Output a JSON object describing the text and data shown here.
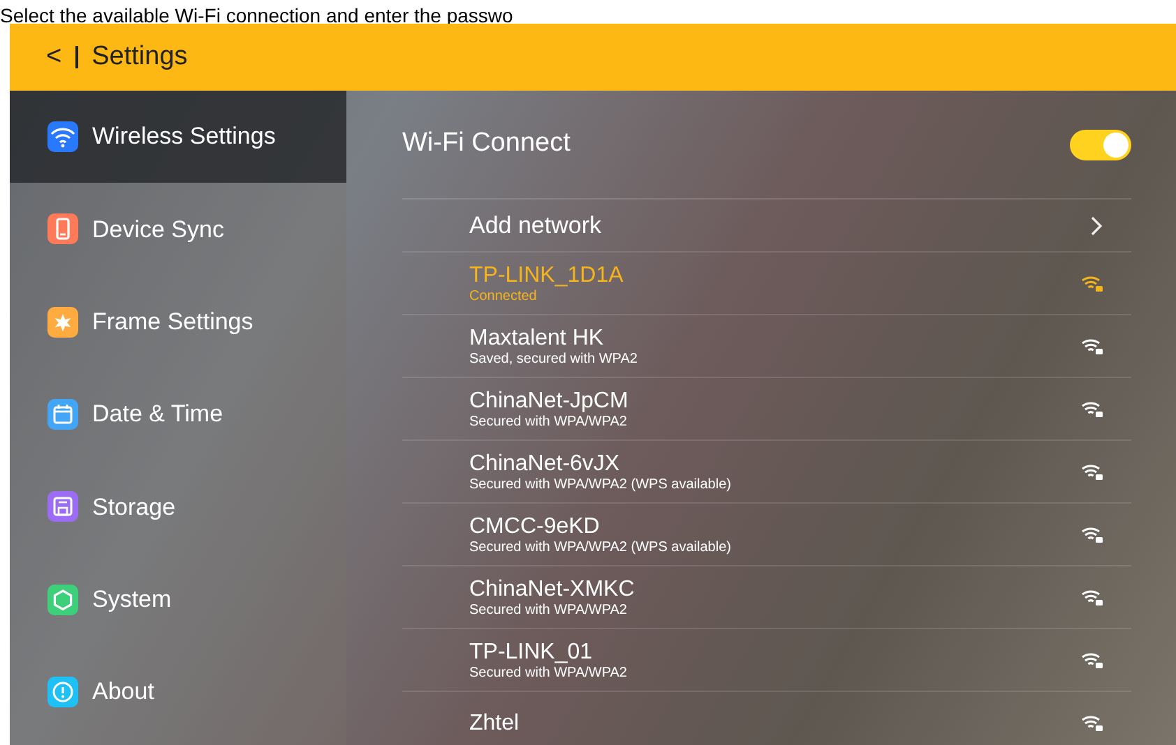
{
  "caption": "Select the available Wi-Fi connection and enter the passwo",
  "top_bar": {
    "back": "<",
    "title": "Settings"
  },
  "sidebar": {
    "items": [
      {
        "label": "Wireless Settings",
        "color": "#2979ff",
        "selected": true
      },
      {
        "label": "Device Sync",
        "color": "#ff7a59",
        "selected": false
      },
      {
        "label": "Frame Settings",
        "color": "#ffab40",
        "selected": false
      },
      {
        "label": "Date & Time",
        "color": "#42a5f5",
        "selected": false
      },
      {
        "label": "Storage",
        "color": "#9c6cf5",
        "selected": false
      },
      {
        "label": "System",
        "color": "#3ecf7a",
        "selected": false
      },
      {
        "label": "About",
        "color": "#1ec0f5",
        "selected": false
      }
    ]
  },
  "wifi_connect": {
    "label": "Wi-Fi Connect",
    "on": true
  },
  "add_network": {
    "label": "Add network"
  },
  "networks": [
    {
      "name": "TP-LINK_1D1A",
      "status": "Connected",
      "connected": true
    },
    {
      "name": "Maxtalent HK",
      "status": "Saved, secured with WPA2",
      "connected": false
    },
    {
      "name": "ChinaNet-JpCM",
      "status": "Secured with WPA/WPA2",
      "connected": false
    },
    {
      "name": "ChinaNet-6vJX",
      "status": "Secured with WPA/WPA2 (WPS available)",
      "connected": false
    },
    {
      "name": "CMCC-9eKD",
      "status": "Secured with WPA/WPA2 (WPS available)",
      "connected": false
    },
    {
      "name": "ChinaNet-XMKC",
      "status": "Secured with WPA/WPA2",
      "connected": false
    },
    {
      "name": "TP-LINK_01",
      "status": "Secured with WPA/WPA2",
      "connected": false
    },
    {
      "name": "Zhtel",
      "connected": false
    }
  ]
}
